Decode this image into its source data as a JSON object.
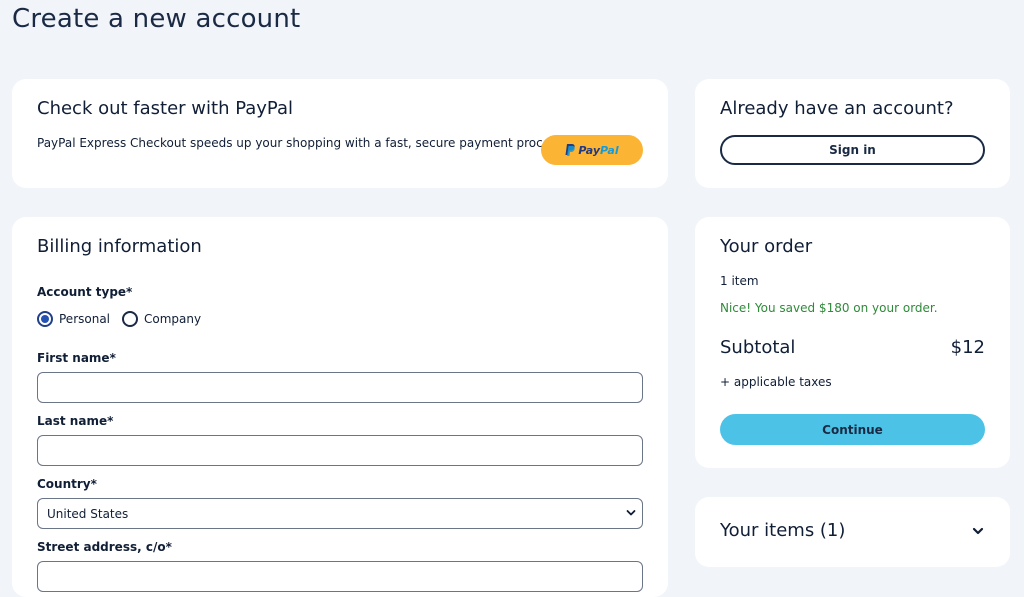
{
  "page": {
    "title": "Create a new account"
  },
  "paypal": {
    "heading": "Check out faster with PayPal",
    "description": "PayPal Express Checkout speeds up your shopping with a fast, secure payment process.",
    "button_pay": "Pay",
    "button_pal": "Pal",
    "brand_colors": {
      "button_bg": "#fbb434",
      "pay": "#253b80",
      "pal": "#179bd7"
    }
  },
  "signin": {
    "heading": "Already have an account?",
    "button_label": "Sign in"
  },
  "billing": {
    "heading": "Billing information",
    "account_type": {
      "label": "Account type*",
      "options": [
        {
          "label": "Personal",
          "checked": true
        },
        {
          "label": "Company",
          "checked": false
        }
      ]
    },
    "first_name": {
      "label": "First name*",
      "value": ""
    },
    "last_name": {
      "label": "Last name*",
      "value": ""
    },
    "country": {
      "label": "Country*",
      "selected": "United States"
    },
    "street": {
      "label": "Street address, c/o*",
      "value": ""
    }
  },
  "order": {
    "heading": "Your order",
    "item_count": "1 item",
    "savings": "Nice! You saved $180 on your order.",
    "subtotal_label": "Subtotal",
    "subtotal_value": "$12",
    "taxes_note": "+ applicable taxes",
    "continue_label": "Continue",
    "colors": {
      "savings": "#2f8a3a",
      "continue_bg": "#4cc3e6"
    }
  },
  "items": {
    "heading": "Your items (1)",
    "icon": "chevron-down-icon"
  }
}
